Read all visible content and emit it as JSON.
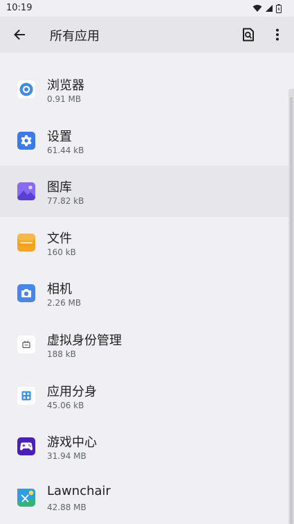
{
  "status_bar": {
    "time": "10:19"
  },
  "app_bar": {
    "title": "所有应用"
  },
  "apps": [
    {
      "name": "浏览器",
      "size": "0.91 MB",
      "icon": "browser-icon"
    },
    {
      "name": "设置",
      "size": "61.44 kB",
      "icon": "settings-icon"
    },
    {
      "name": "图库",
      "size": "77.82 kB",
      "icon": "gallery-icon"
    },
    {
      "name": "文件",
      "size": "160 kB",
      "icon": "files-icon"
    },
    {
      "name": "相机",
      "size": "2.26 MB",
      "icon": "camera-icon"
    },
    {
      "name": "虚拟身份管理",
      "size": "188 kB",
      "icon": "virtual-identity-icon"
    },
    {
      "name": "应用分身",
      "size": "45.06 kB",
      "icon": "app-clone-icon"
    },
    {
      "name": "游戏中心",
      "size": "31.94 MB",
      "icon": "game-center-icon"
    },
    {
      "name": "Lawnchair",
      "size": "42.88 MB",
      "icon": "lawnchair-icon"
    }
  ],
  "colors": {
    "background": "#f0f0f4",
    "app_bar": "#e6e6ea",
    "selected_row": "#e7e7eb",
    "accent_blue": "#3b7be6"
  }
}
